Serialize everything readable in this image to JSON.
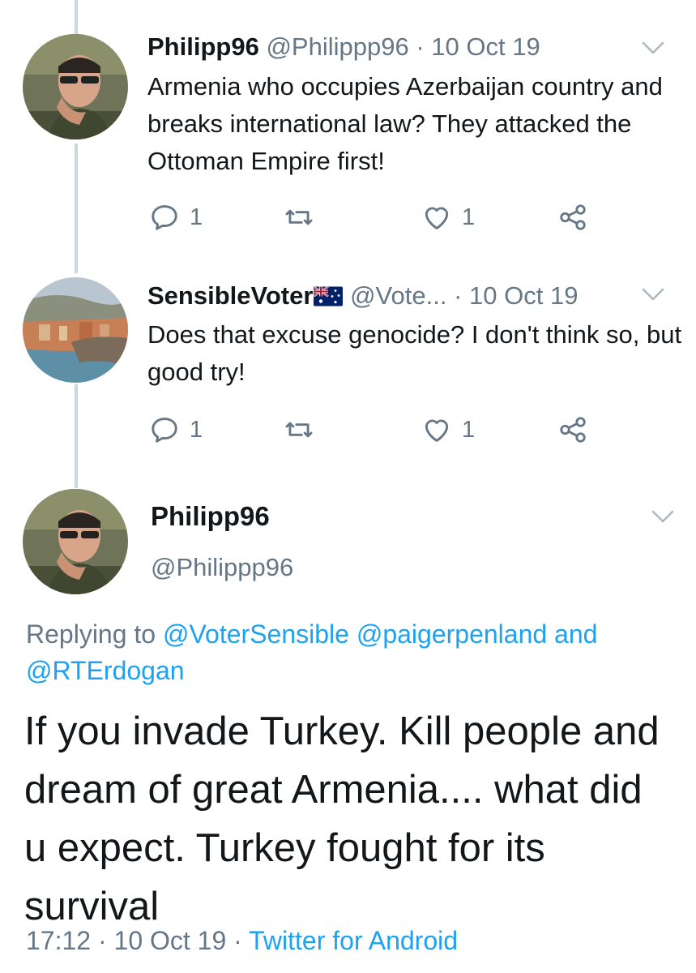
{
  "thread": [
    {
      "name": "Philipp96",
      "handle": "@Philippp96",
      "separator": "·",
      "date": "10 Oct 19",
      "text": "Armenia who occupies Azerbaijan country and breaks international law? They attacked the Ottoman Empire first!",
      "reply_count": "1",
      "like_count": "1"
    },
    {
      "name": "SensibleVoter",
      "handle": "@Vote...",
      "separator": "·",
      "date": "10 Oct 19",
      "text": "Does that excuse genocide? I don't think so, but good try!",
      "reply_count": "1",
      "like_count": "1"
    }
  ],
  "main_tweet": {
    "name": "Philipp96",
    "handle": "@Philippp96",
    "replying_label": "Replying to",
    "reply_to_1": "@VoterSensible",
    "reply_to_2": "@paigerpenland",
    "reply_and": "and",
    "reply_to_3": "@RTErdogan",
    "text": "If you invade Turkey. Kill people and dream of great Armenia.... what did u expect. Turkey fought for its survival",
    "time": "17:12",
    "separator": "·",
    "date": "10 Oct 19",
    "source": "Twitter for Android"
  },
  "icons": [
    "reply-icon",
    "retweet-icon",
    "like-icon",
    "share-icon",
    "chevron-down-icon",
    "australia-flag-icon"
  ],
  "colors": {
    "text": "#14171a",
    "secondary": "#657786",
    "link": "#1da1f2",
    "thread_line": "#ccd6dd"
  }
}
